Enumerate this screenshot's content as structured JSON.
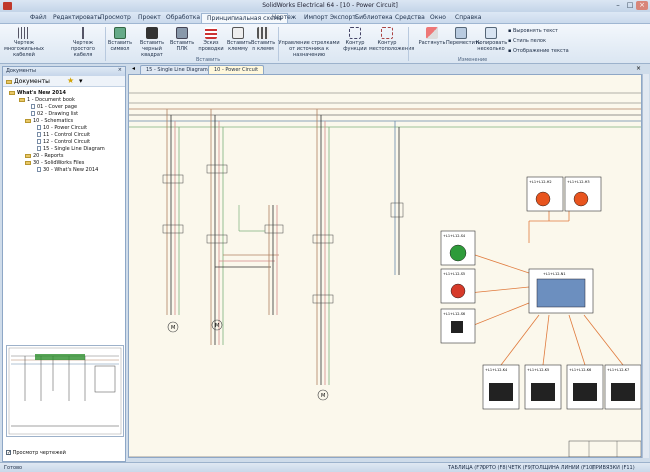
{
  "window": {
    "title": "SolidWorks Electrical 64 - [10 - Power Circuit]"
  },
  "menu": [
    "Файл",
    "Редактировать",
    "Просмотр",
    "Проект",
    "Обработка",
    "Принципиальная схема",
    "Чертеж",
    "Импорт Экспорт",
    "Библиотека",
    "Средства",
    "Окно",
    "Справка"
  ],
  "ribbon": {
    "buttons": [
      "Чертеж многожильных кабелей",
      "Чертеж простого кабеля",
      "Вставить символ",
      "Вставить черный квадрат",
      "Вставить ПЛК",
      "Эскиз проводки",
      "Вставить клемму",
      "Вставить n клемм",
      "Управление стрелками от источника к назначению",
      "Контур функции",
      "Контур местоположения",
      "Растянуть",
      "Переместить",
      "Копировать несколько"
    ],
    "small_buttons": [
      "Выровнять текст",
      "Стиль пелок",
      "Отображение текста"
    ],
    "groups": [
      "Вставить",
      "Изменение"
    ]
  },
  "left_panel": {
    "header": "Документы",
    "tab": "Документы",
    "tree": [
      "What's New 2014",
      "1 - Document book",
      "01 - Cover page",
      "02 - Drawing list",
      "10 - Schematics",
      "10 - Power Circuit",
      "11 - Control Circuit",
      "12 - Control Circuit",
      "15 - Single Line Diagram",
      "20 - Reports",
      "30 - SolidWorks Files",
      "30 - What's New 2014"
    ],
    "checkbox": "Просмотр чертежей"
  },
  "tabs": [
    "15 - Single Line Diagram",
    "10 - Power Circuit"
  ],
  "schematic": {
    "labels": [
      "+L1+L12-S4",
      "+L1+L12-S5",
      "+L1+L12-S6",
      "+L1+L12-N1",
      "+L1+L12-H2",
      "+L1+L12-H3",
      "+L1+L12-K4",
      "+L1+L12-K5",
      "+L1+L12-K6",
      "+L1+L12-K7"
    ],
    "colors": {
      "canvas": "#fbf8ec",
      "brown": "#b08060",
      "pink": "#d48a8a",
      "green": "#7cb07c",
      "blue": "#6688aa",
      "orange": "#e07a3c"
    }
  },
  "status": {
    "left": "Готово",
    "items": [
      "ТАБЛИЦА (F7)",
      "ОРТО (F8)",
      "ЧЕТК (F9)",
      "ТОЛЩИНА ЛИНИИ (F10)",
      "ПРИВЯЗКИ (F11)"
    ]
  }
}
